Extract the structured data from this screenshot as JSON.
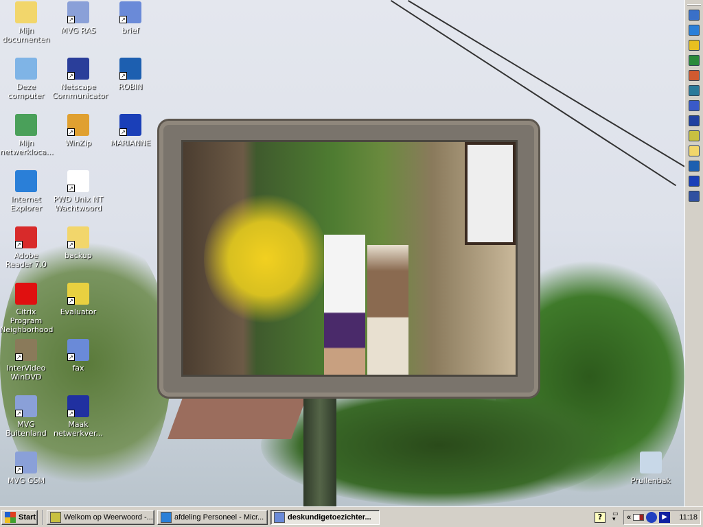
{
  "desktop_icons": [
    {
      "label": "Mijn documenten",
      "icon": "my-documents-icon",
      "color": "#f2d66b",
      "shortcut": false
    },
    {
      "label": "Deze computer",
      "icon": "my-computer-icon",
      "color": "#7fb4e6",
      "shortcut": false
    },
    {
      "label": "Mijn netwerkloca...",
      "icon": "network-places-icon",
      "color": "#4aa05a",
      "shortcut": false
    },
    {
      "label": "Internet Explorer",
      "icon": "internet-explorer-icon",
      "color": "#2a7fd8",
      "shortcut": false
    },
    {
      "label": "Adobe Reader 7.0",
      "icon": "adobe-reader-icon",
      "color": "#d82a2a",
      "shortcut": true
    },
    {
      "label": "Citrix Program Neighborhood",
      "icon": "citrix-icon",
      "color": "#e01010",
      "shortcut": false
    },
    {
      "label": "InterVideo WinDVD",
      "icon": "windvd-icon",
      "color": "#8a7a5a",
      "shortcut": true
    },
    {
      "label": "MVG Buitenland",
      "icon": "network-connection-icon",
      "color": "#8aa0d8",
      "shortcut": true
    },
    {
      "label": "MVG GSM",
      "icon": "network-connection-icon",
      "color": "#8aa0d8",
      "shortcut": true
    },
    {
      "label": "MVG RAS",
      "icon": "network-connection-icon",
      "color": "#8aa0d8",
      "shortcut": true
    },
    {
      "label": "Netscape Communicator",
      "icon": "netscape-icon",
      "color": "#2a3e9a",
      "shortcut": true
    },
    {
      "label": "WinZip",
      "icon": "winzip-icon",
      "color": "#e0a030",
      "shortcut": true
    },
    {
      "label": "PWD Unix NT Wachtwoord",
      "icon": "password-icon",
      "color": "#ffffff",
      "shortcut": true
    },
    {
      "label": "backup",
      "icon": "folder-icon",
      "color": "#f2d66b",
      "shortcut": true
    },
    {
      "label": "Evaluator",
      "icon": "evaluator-icon",
      "color": "#e8d040",
      "shortcut": true
    },
    {
      "label": "fax",
      "icon": "word-document-icon",
      "color": "#6a8ad8",
      "shortcut": true
    },
    {
      "label": "Maak netwerkver...",
      "icon": "setup-wizard-icon",
      "color": "#2030a0",
      "shortcut": true
    },
    {
      "label": "brief",
      "icon": "word-document-icon",
      "color": "#6a8ad8",
      "shortcut": true
    },
    {
      "label": "ROBIN",
      "icon": "robin-icon",
      "color": "#1d5fb0",
      "shortcut": true
    },
    {
      "label": "MARIANNE",
      "icon": "marianne-icon",
      "color": "#1a3fb8",
      "shortcut": true
    },
    {
      "label": "Prullenbak",
      "icon": "recycle-bin-icon",
      "color": "#c8d8e8",
      "shortcut": false
    }
  ],
  "taskbar": {
    "start_label": "Start",
    "tasks": [
      {
        "label": "Welkom op Weerwoord -...",
        "icon": "weerwoord-icon",
        "color": "#c8c040",
        "active": false
      },
      {
        "label": "afdeling Personeel - Micr...",
        "icon": "internet-explorer-icon",
        "color": "#2a7fd8",
        "active": false
      },
      {
        "label": "deskundigetoezichter...",
        "icon": "word-document-icon",
        "color": "#6a8ad8",
        "active": true
      }
    ],
    "clock": "11:18",
    "tray_expand": "«"
  },
  "quick_launch": [
    {
      "icon": "outlook-icon",
      "color": "#3a70c8"
    },
    {
      "icon": "internet-explorer-icon",
      "color": "#2a7fd8"
    },
    {
      "icon": "key-icon",
      "color": "#e8c020"
    },
    {
      "icon": "excel-icon",
      "color": "#2a8a3a"
    },
    {
      "icon": "powerpoint-icon",
      "color": "#d05a30"
    },
    {
      "icon": "publisher-icon",
      "color": "#2a7a9a"
    },
    {
      "icon": "word-icon",
      "color": "#3a5ac8"
    },
    {
      "icon": "evaluator-icon",
      "color": "#2040a0"
    },
    {
      "icon": "weerwoord-icon",
      "color": "#c8c040"
    },
    {
      "icon": "folder-icon",
      "color": "#f2d66b"
    },
    {
      "icon": "robin-icon",
      "color": "#1d5fb0"
    },
    {
      "icon": "marianne-icon",
      "color": "#1a3fb8"
    },
    {
      "icon": "media-player-icon",
      "color": "#3050a0"
    }
  ]
}
